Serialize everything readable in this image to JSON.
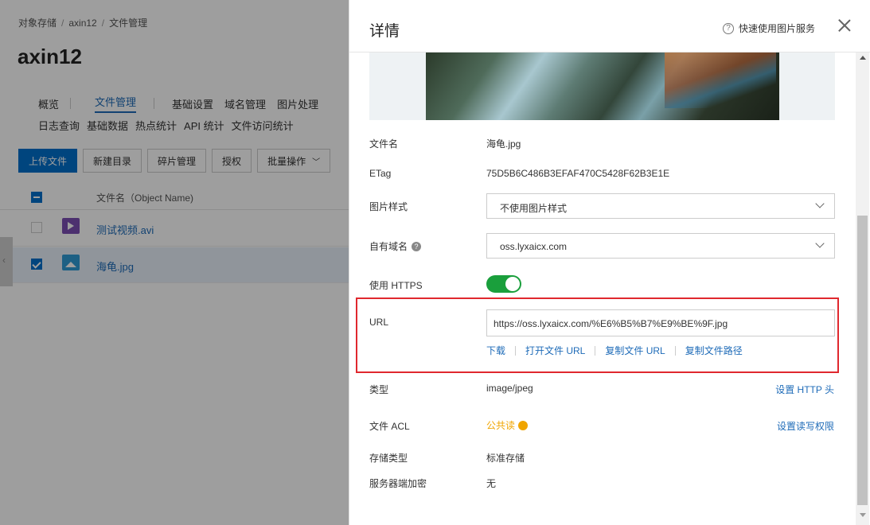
{
  "background": {
    "breadcrumb": [
      "对象存储",
      "axin12",
      "文件管理"
    ],
    "title": "axin12",
    "nav_row1": [
      "概览",
      "文件管理",
      "基础设置",
      "域名管理",
      "图片处理"
    ],
    "nav_row2": [
      "日志查询",
      "基础数据",
      "热点统计",
      "API 统计",
      "文件访问统计"
    ],
    "toolbar": {
      "upload": "上传文件",
      "new_dir": "新建目录",
      "fragments": "碎片管理",
      "authorize": "授权",
      "batch": "批量操作"
    },
    "table_header": "文件名（Object Name)",
    "files": [
      {
        "name": "测试视频.avi",
        "type": "video",
        "selected": false
      },
      {
        "name": "海龟.jpg",
        "type": "image",
        "selected": true
      }
    ]
  },
  "drawer": {
    "title": "详情",
    "help": "快速使用图片服务",
    "fields": {
      "filename_label": "文件名",
      "filename": "海龟.jpg",
      "etag_label": "ETag",
      "etag": "75D5B6C486B3EFAF470C5428F62B3E1E",
      "style_label": "图片样式",
      "style_value": "不使用图片样式",
      "domain_label": "自有域名",
      "domain_value": "oss.lyxaicx.com",
      "https_label": "使用 HTTPS",
      "https_on": true,
      "url_label": "URL",
      "url": "https://oss.lyxaicx.com/%E6%B5%B7%E9%BE%9F.jpg",
      "url_links": [
        "下载",
        "打开文件 URL",
        "复制文件 URL",
        "复制文件路径"
      ],
      "type_label": "类型",
      "type": "image/jpeg",
      "set_http_header": "设置 HTTP 头",
      "acl_label": "文件 ACL",
      "acl": "公共读",
      "set_acl": "设置读写权限",
      "storage_label": "存储类型",
      "storage": "标准存储",
      "encrypt_label": "服务器端加密",
      "encrypt": "无"
    },
    "colors": {
      "highlight_border": "#e0282e",
      "toggle_on": "#1a9f3c",
      "link": "#1e6bb8",
      "acl": "#f0a500"
    }
  }
}
